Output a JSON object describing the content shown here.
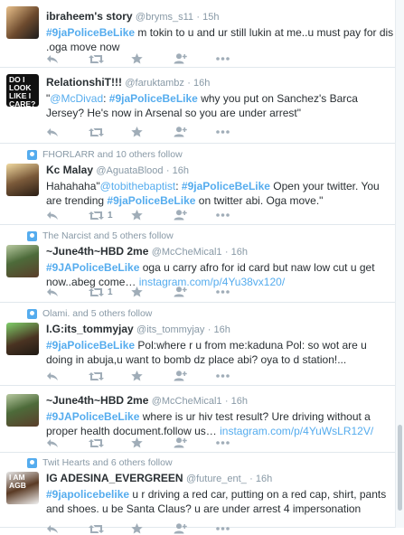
{
  "tweets": [
    {
      "context": "",
      "name": "ibraheem's story",
      "handle": "@bryms_s11",
      "time": "· 15h",
      "parts": [
        [
          "#9jaPoliceBeLike",
          "ht"
        ],
        [
          " m tokin to u and ur still lukin at me..u must pay for dis .oga move now",
          ""
        ]
      ],
      "retweet_count": ""
    },
    {
      "context": "",
      "name": "RelationshiT!!!",
      "handle": "@faruktambz",
      "time": "· 16h",
      "parts": [
        [
          "\"",
          ""
        ],
        [
          "@McDivad",
          "mn"
        ],
        [
          ": ",
          ""
        ],
        [
          "#9jaPoliceBeLike",
          "ht"
        ],
        [
          " why you put on Sanchez's Barca Jersey? He's now in Arsenal so you are under arrest\"",
          ""
        ]
      ],
      "avatar_text": "DO I LOOK LIKE I CARE?",
      "retweet_count": ""
    },
    {
      "context": "FHORLARR and 10 others follow",
      "name": "Kc Malay",
      "handle": "@AguataBlood",
      "time": "· 16h",
      "parts": [
        [
          "Hahahaha\"",
          ""
        ],
        [
          "@tobithebaptist",
          "mn"
        ],
        [
          ": ",
          ""
        ],
        [
          "#9jaPoliceBeLike",
          "ht"
        ],
        [
          " Open your twitter. You are trending ",
          ""
        ],
        [
          "#9jaPoliceBeLike",
          "ht"
        ],
        [
          " on twitter abi. Oga move.\"",
          ""
        ]
      ],
      "retweet_count": "1"
    },
    {
      "context": "The Narcist and 5 others follow",
      "name": "~June4th~HBD 2me",
      "handle": "@McCheMical1",
      "time": "· 16h",
      "parts": [
        [
          "#9JAPoliceBeLike",
          "ht"
        ],
        [
          " oga u carry afro for id card but naw low cut u get now..abeg come… ",
          ""
        ],
        [
          "instagram.com/p/4Yu38vx120/",
          "mn"
        ]
      ],
      "retweet_count": "1"
    },
    {
      "context": "Olami. and 5 others follow",
      "name": "I.G:its_tommyjay",
      "handle": "@its_tommyjay",
      "time": "· 16h",
      "parts": [
        [
          "#9jaPoliceBeLike",
          "ht"
        ],
        [
          " Pol:where r u from me:kaduna  Pol: so wot are u doing in abuja,u want to bomb dz place abi? oya to d station!...",
          ""
        ]
      ],
      "retweet_count": ""
    },
    {
      "context": "",
      "name": "~June4th~HBD 2me",
      "handle": "@McCheMical1",
      "time": "· 16h",
      "parts": [
        [
          "#9JAPoliceBeLike",
          "ht"
        ],
        [
          " where is  ur hiv test result? Ure driving without a proper health document.follow us… ",
          ""
        ],
        [
          "instagram.com/p/4YuWsLR12V/",
          "mn"
        ]
      ],
      "retweet_count": ""
    },
    {
      "context": "Twit Hearts and 6 others follow",
      "name": "IG ADESINA_EVERGREEN",
      "handle": "@future_ent_",
      "time": "· 16h",
      "parts": [
        [
          "#9japolicebelike",
          "ht"
        ],
        [
          " u r driving a red car, putting on a red cap, shirt, pants and shoes. u be Santa Claus? u are under arrest 4 impersonation",
          ""
        ]
      ],
      "avatar_text": "I AM AGB",
      "retweet_count": ""
    }
  ],
  "colors": {
    "link": "#55acee",
    "muted": "#8899a6",
    "icon": "#a0adb8"
  }
}
